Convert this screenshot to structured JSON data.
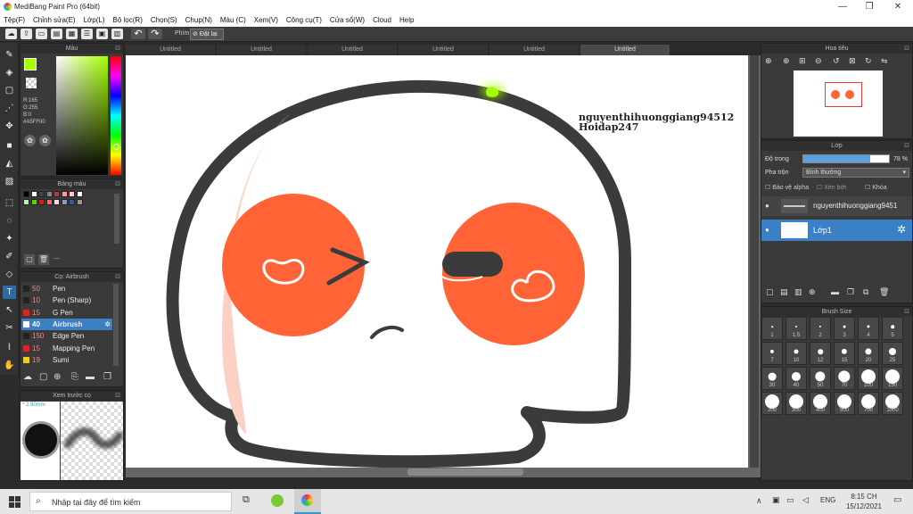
{
  "window": {
    "title": "MediBang Paint Pro (64bit)",
    "minimize": "—",
    "maximize": "❐",
    "close": "✕"
  },
  "menu": [
    "Tệp(F)",
    "Chỉnh sửa(E)",
    "Lớp(L)",
    "Bộ lọc(R)",
    "Chọn(S)",
    "Chụp(N)",
    "Màu (C)",
    "Xem(V)",
    "Công cụ(T)",
    "Cửa sổ(W)",
    "Cloud",
    "Help"
  ],
  "toolbar": {
    "undo": "↶",
    "redo": "↷",
    "phim_label": "Phím",
    "reset_label": "Đặt lại"
  },
  "tabs": [
    "Untitled",
    "Untitled",
    "Untitled",
    "Untitled",
    "Untitled",
    "Untitled"
  ],
  "color_panel": {
    "title": "Màu",
    "r": "R:165",
    "g": "G:255",
    "b": "B:0",
    "hex": "#A5FF00",
    "fg_color": "#A5FF00"
  },
  "palette_panel": {
    "title": "Bảng màu",
    "status": "---",
    "swatches": [
      "#000000",
      "#ffffff",
      "#444444",
      "#888888",
      "#cc3333",
      "#ff99aa",
      "#ffcccc",
      "#ffffff",
      "#aaffaa",
      "#66cc00",
      "#cc2222",
      "#ff6666",
      "#ffdddd",
      "#8899bb",
      "#445588",
      "#999999"
    ]
  },
  "brush_panel": {
    "title": "Cọ: Airbrush",
    "items": [
      {
        "size": "50",
        "name": "Pen",
        "color": "#222222"
      },
      {
        "size": "10",
        "name": "Pen (Sharp)",
        "color": "#222222"
      },
      {
        "size": "15",
        "name": "G Pen",
        "color": "#dd2222"
      },
      {
        "size": "40",
        "name": "Airbrush",
        "color": "#ffffff"
      },
      {
        "size": "150",
        "name": "Edge Pen",
        "color": "#222222"
      },
      {
        "size": "15",
        "name": "Mapping Pen",
        "color": "#dd2222"
      },
      {
        "size": "19",
        "name": "Sumi",
        "color": "#eecc22"
      }
    ]
  },
  "preview_panel": {
    "title": "Xem trước cọ",
    "size": "* 2.90mm"
  },
  "canvas": {
    "watermark_line1": "nguyenthihuonggiang94512",
    "watermark_line2": "Hoidap247"
  },
  "navigator_panel": {
    "title": "Hoa tiêu"
  },
  "layer_panel": {
    "title": "Lớp",
    "opacity_label": "Độ trong",
    "opacity_value": "78 %",
    "opacity_percent": 78,
    "blend_label": "Pha trộn",
    "blend_value": "Bình thường",
    "protect_alpha": "Bảo vệ alpha",
    "clip": "Xén bớt",
    "lock": "Khóa",
    "layers": [
      {
        "name": "nguyenthihuonggiang9451"
      },
      {
        "name": "Lớp1"
      }
    ]
  },
  "brush_size_panel": {
    "title": "Brush Size",
    "sizes": [
      "1",
      "1.5",
      "2",
      "3",
      "4",
      "5",
      "7",
      "10",
      "12",
      "15",
      "20",
      "25",
      "30",
      "40",
      "50",
      "70",
      "100",
      "150",
      "200",
      "300",
      "400",
      "500",
      "700",
      "1000"
    ]
  },
  "taskbar": {
    "search_placeholder": "Nhập tại đây để tìm kiếm",
    "lang": "ENG",
    "time": "8:15 CH",
    "date": "15/12/2021"
  }
}
